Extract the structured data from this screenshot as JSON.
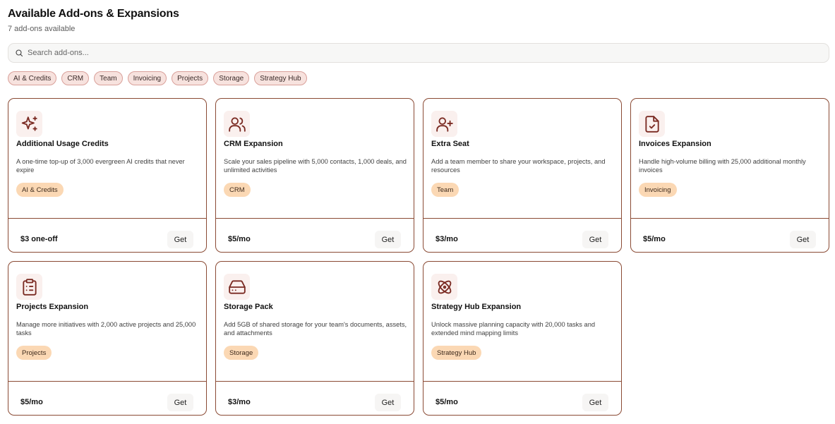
{
  "header": {
    "title": "Available Add-ons & Expansions",
    "subtitle": "7 add-ons available"
  },
  "search": {
    "placeholder": "Search add-ons..."
  },
  "filters": [
    "AI & Credits",
    "CRM",
    "Team",
    "Invoicing",
    "Projects",
    "Storage",
    "Strategy Hub"
  ],
  "colors": {
    "border": "#8a4a34",
    "icon": "#7a2a22",
    "tag_bg": "#fbd8b4",
    "chip_bg": "#f7e2de"
  },
  "button_label": "Get",
  "addons": [
    {
      "name": "Additional Usage Credits",
      "description": "A one-time top-up of 3,000 evergreen AI credits that never expire",
      "tag": "AI & Credits",
      "price": "$3 one-off",
      "icon": "sparkles-icon"
    },
    {
      "name": "CRM Expansion",
      "description": "Scale your sales pipeline with 5,000 contacts, 1,000 deals, and unlimited activities",
      "tag": "CRM",
      "price": "$5/mo",
      "icon": "users-icon"
    },
    {
      "name": "Extra Seat",
      "description": "Add a team member to share your workspace, projects, and resources",
      "tag": "Team",
      "price": "$3/mo",
      "icon": "user-plus-icon"
    },
    {
      "name": "Invoices Expansion",
      "description": "Handle high-volume billing with 25,000 additional monthly invoices",
      "tag": "Invoicing",
      "price": "$5/mo",
      "icon": "file-check-icon"
    },
    {
      "name": "Projects Expansion",
      "description": "Manage more initiatives with 2,000 active projects and 25,000 tasks",
      "tag": "Projects",
      "price": "$5/mo",
      "icon": "clipboard-list-icon"
    },
    {
      "name": "Storage Pack",
      "description": "Add 5GB of shared storage for your team's documents, assets, and attachments",
      "tag": "Storage",
      "price": "$3/mo",
      "icon": "hard-drive-icon"
    },
    {
      "name": "Strategy Hub Expansion",
      "description": "Unlock massive planning capacity with 20,000 tasks and extended mind mapping limits",
      "tag": "Strategy Hub",
      "price": "$5/mo",
      "icon": "atom-icon"
    }
  ]
}
